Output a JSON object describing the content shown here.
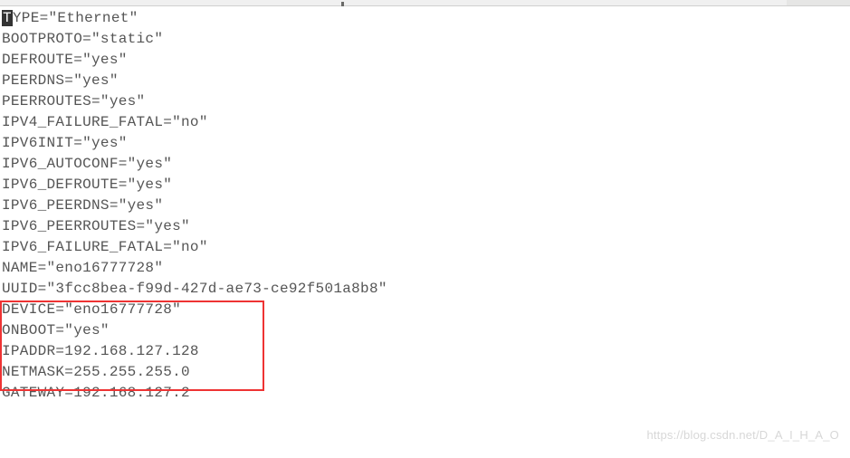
{
  "config": {
    "lines": [
      "TYPE=\"Ethernet\"",
      "BOOTPROTO=\"static\"",
      "DEFROUTE=\"yes\"",
      "PEERDNS=\"yes\"",
      "PEERROUTES=\"yes\"",
      "IPV4_FAILURE_FATAL=\"no\"",
      "IPV6INIT=\"yes\"",
      "IPV6_AUTOCONF=\"yes\"",
      "IPV6_DEFROUTE=\"yes\"",
      "IPV6_PEERDNS=\"yes\"",
      "IPV6_PEERROUTES=\"yes\"",
      "IPV6_FAILURE_FATAL=\"no\"",
      "NAME=\"eno16777728\"",
      "UUID=\"3fcc8bea-f99d-427d-ae73-ce92f501a8b8\"",
      "DEVICE=\"eno16777728\"",
      "ONBOOT=\"yes\"",
      "IPADDR=192.168.127.128",
      "NETMASK=255.255.255.0",
      "GATEWAY=192.168.127.2"
    ],
    "cursor_first_char": "T",
    "first_line_rest": "YPE=\"Ethernet\""
  },
  "watermark": "https://blog.csdn.net/D_A_I_H_A_O"
}
